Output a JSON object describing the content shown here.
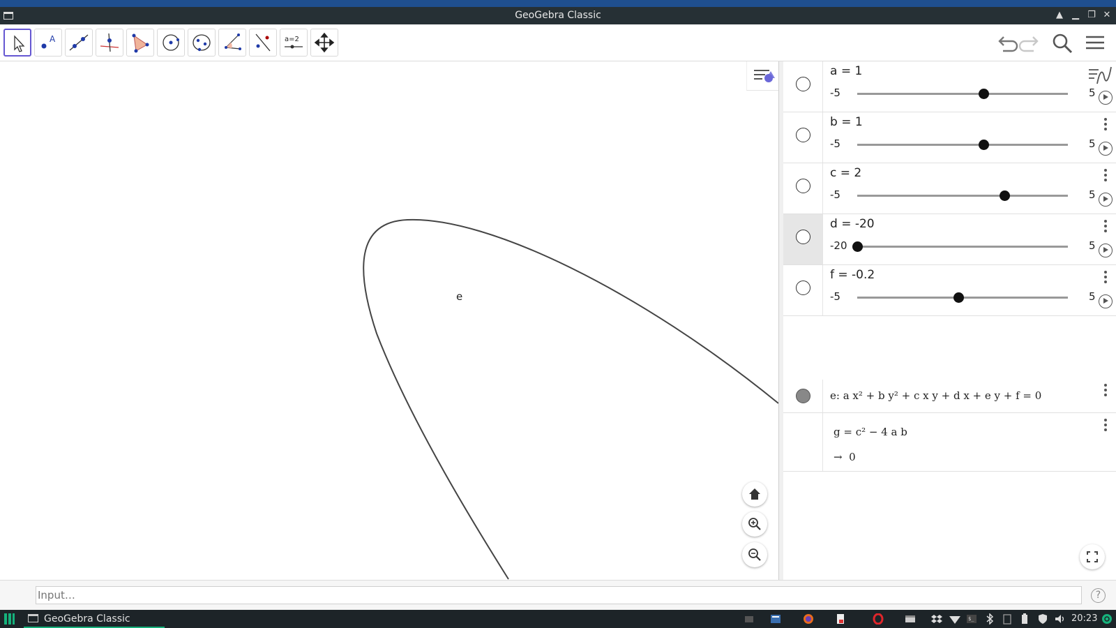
{
  "window": {
    "title": "GeoGebra Classic"
  },
  "toolbar": {
    "tools": [
      "Move",
      "Point",
      "Line",
      "Perpendicular Line",
      "Polygon",
      "Circle with Center",
      "Ellipse",
      "Angle",
      "Reflect",
      "Slider",
      "Move Graphics View"
    ],
    "slider_icon_text": "a=2"
  },
  "graphics": {
    "curve_label": "e"
  },
  "algebra": {
    "sliders": [
      {
        "name": "a",
        "definition": "a = 1",
        "min": "-5",
        "max": "5",
        "value": 1,
        "min_num": -5,
        "max_num": 5
      },
      {
        "name": "b",
        "definition": "b = 1",
        "min": "-5",
        "max": "5",
        "value": 1,
        "min_num": -5,
        "max_num": 5
      },
      {
        "name": "c",
        "definition": "c = 2",
        "min": "-5",
        "max": "5",
        "value": 2,
        "min_num": -5,
        "max_num": 5
      },
      {
        "name": "d",
        "definition": "d = -20",
        "min": "-20",
        "max": "5",
        "value": -20,
        "min_num": -20,
        "max_num": 5
      },
      {
        "name": "f",
        "definition": "f = -0.2",
        "min": "-5",
        "max": "5",
        "value": -0.2,
        "min_num": -5,
        "max_num": 5
      }
    ],
    "conic": {
      "label": "e:",
      "equation": "a x² + b y² + c x y + d x + e y + f = 0"
    },
    "discriminant": {
      "definition": "g = c² − 4 a b",
      "arrow": "→",
      "result": "0"
    }
  },
  "input": {
    "placeholder": "Input…",
    "help": "?"
  },
  "taskbar": {
    "task_label": "GeoGebra Classic",
    "clock": "20:23"
  }
}
